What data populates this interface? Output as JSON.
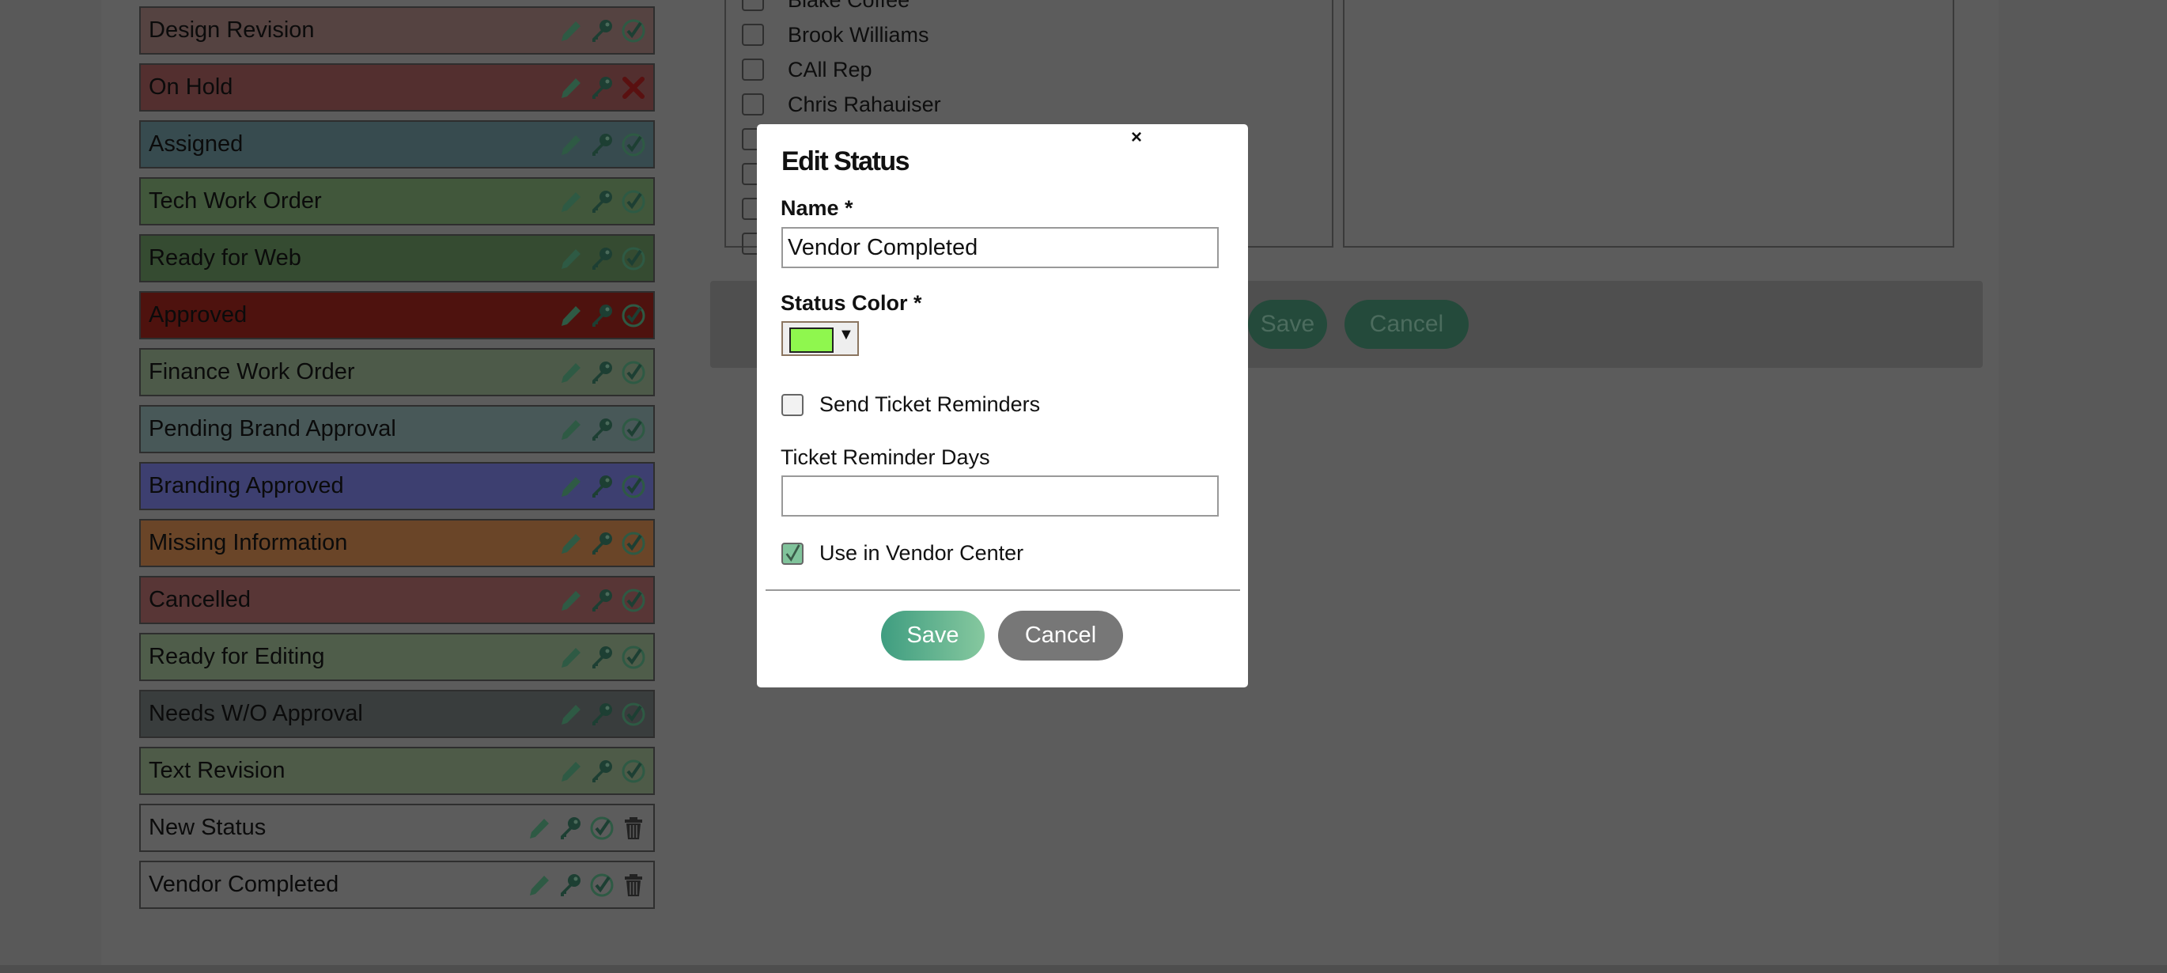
{
  "statuses": [
    {
      "label": "Design Revision",
      "color": "#554341",
      "active": true,
      "deletable": false
    },
    {
      "label": "On Hold",
      "color": "#532f2f",
      "active": false,
      "deletable": false
    },
    {
      "label": "Assigned",
      "color": "#374b4f",
      "active": true,
      "deletable": false
    },
    {
      "label": "Tech Work Order",
      "color": "#41573b",
      "active": true,
      "deletable": false
    },
    {
      "label": "Ready for Web",
      "color": "#354b31",
      "active": true,
      "deletable": false
    },
    {
      "label": "Approved",
      "color": "#4e120e",
      "active": true,
      "deletable": false
    },
    {
      "label": "Finance Work Order",
      "color": "#4d5a49",
      "active": true,
      "deletable": false
    },
    {
      "label": "Pending Brand Approval",
      "color": "#485858",
      "active": true,
      "deletable": false
    },
    {
      "label": "Branding Approved",
      "color": "#3d3f70",
      "active": true,
      "deletable": false
    },
    {
      "label": "Missing Information",
      "color": "#6a4528",
      "active": true,
      "deletable": false
    },
    {
      "label": "Cancelled",
      "color": "#583636",
      "active": true,
      "deletable": false
    },
    {
      "label": "Ready for Editing",
      "color": "#4f5d4a",
      "active": true,
      "deletable": false
    },
    {
      "label": "Needs W/O Approval",
      "color": "#393d3d",
      "active": true,
      "deletable": false
    },
    {
      "label": "Text Revision",
      "color": "#4e5b48",
      "active": true,
      "deletable": false
    },
    {
      "label": "New Status",
      "color": "#5c5c5c",
      "active": true,
      "deletable": true
    },
    {
      "label": "Vendor Completed",
      "color": "#5c5c5c",
      "active": true,
      "deletable": true
    }
  ],
  "users": [
    "Blake Coffee",
    "Brook Williams",
    "CAll Rep",
    "Chris Rahauiser",
    "",
    "",
    "",
    ""
  ],
  "background_buttons": {
    "save": "Save",
    "cancel": "Cancel"
  },
  "modal": {
    "close": "×",
    "title": "Edit Status",
    "name_label": "Name *",
    "name_value": "Vendor Completed",
    "color_label": "Status Color *",
    "color_value": "#8ff74e",
    "caret": "▼",
    "send_reminders_label": "Send Ticket Reminders",
    "send_reminders_checked": false,
    "reminder_days_label": "Ticket Reminder Days",
    "reminder_days_value": "",
    "vendor_center_label": "Use in Vendor Center",
    "vendor_center_checked": true,
    "save": "Save",
    "cancel": "Cancel"
  },
  "colors": {
    "accent": "#3f9d80",
    "icon_green": "#2e5a44",
    "icon_dark": "#1d3f33",
    "deny_red": "#5a1010"
  }
}
